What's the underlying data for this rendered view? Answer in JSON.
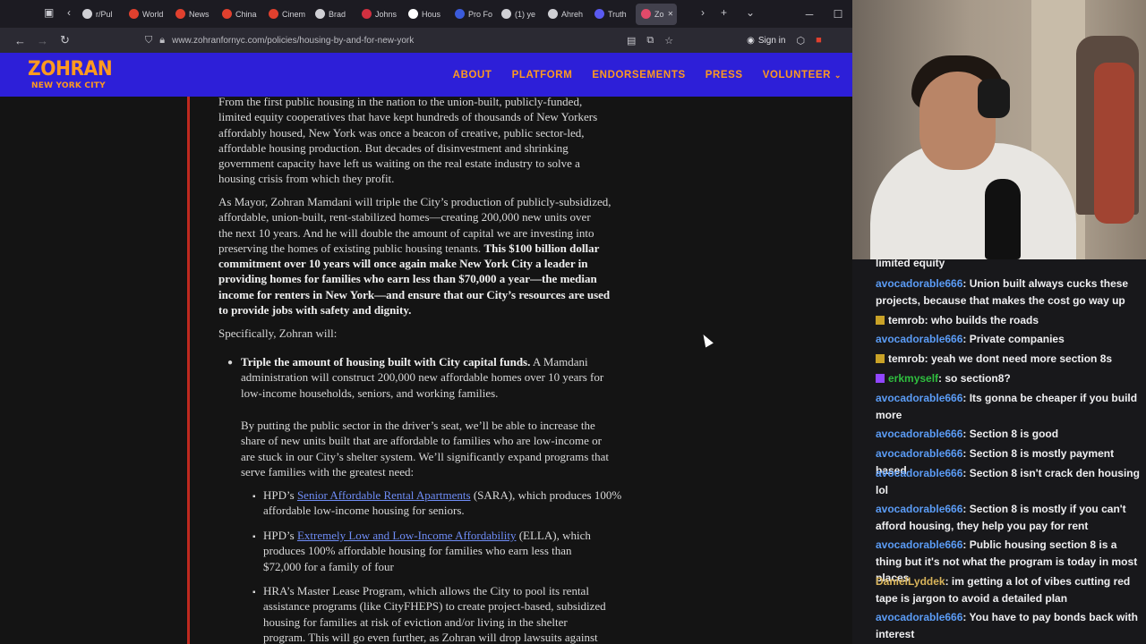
{
  "browser": {
    "tabs": [
      {
        "label": "r/Pul",
        "color": "#d0d0d5"
      },
      {
        "label": "World",
        "color": "#e0402e"
      },
      {
        "label": "News",
        "color": "#e0402e"
      },
      {
        "label": "China",
        "color": "#e0402e"
      },
      {
        "label": "Cinem",
        "color": "#e0402e"
      },
      {
        "label": "Brad",
        "color": "#d0d0d5"
      },
      {
        "label": "Johns",
        "color": "#d03040"
      },
      {
        "label": "Hous",
        "color": "#ffffff"
      },
      {
        "label": "Pro Fo",
        "color": "#3b5bdb"
      },
      {
        "label": "(1) ye",
        "color": "#d0d0d5"
      },
      {
        "label": "Ahreh",
        "color": "#d0d0d5"
      },
      {
        "label": "Truth",
        "color": "#5a5af0"
      },
      {
        "label": "Zo",
        "color": "#e04a6a",
        "active": true
      }
    ],
    "url": "www.zohranfornyc.com/policies/housing-by-and-for-new-york",
    "sign_in": "Sign in"
  },
  "site": {
    "logo": "ZOHRAN",
    "logo_sub": "NEW YORK CITY",
    "nav": [
      "ABOUT",
      "PLATFORM",
      "ENDORSEMENTS",
      "PRESS",
      "VOLUNTEER"
    ]
  },
  "article": {
    "p1": [
      "From the first public housing in the nation to the union-built, publicly-funded,",
      "limited equity cooperatives that have kept hundreds of thousands of New Yorkers",
      "affordably housed, New York was once a beacon of creative, public sector-led,",
      "affordable housing production. But decades of disinvestment and shrinking",
      "government capacity have left us waiting on the real estate industry to solve a",
      "housing crisis from which they profit."
    ],
    "p2": [
      "As Mayor, Zohran Mamdani will triple the City’s production of publicly-subsidized,",
      "affordable, union-built, rent-stabilized homes—creating 200,000 new units over",
      "the next 10 years. And he will double the amount of capital we are investing into",
      "preserving the homes of existing public housing tenants."
    ],
    "p2_bold_start": "This $100 billion dollar",
    "p2_bold": [
      "commitment over 10 years will once again make New York City a leader in",
      "providing homes for families who earn less than $70,000 a year—the median",
      "income for renters in New York—and ensure that our City’s resources are used",
      "to provide jobs with safety and dignity."
    ],
    "p3": "Specifically, Zohran will:",
    "bullet1_bold": "Triple the amount of housing built with City capital funds.",
    "bullet1_rest_start": "A Mamdani",
    "bullet1_rest": [
      "administration will construct 200,000 new affordable homes over 10 years for",
      "low-income households, seniors, and working families."
    ],
    "p4": [
      "By putting the public sector in the driver’s seat, we’ll be able to increase the",
      "share of new units built that are affordable to families who are low-income or",
      "are stuck in our City’s shelter system. We’ll significantly expand programs that",
      "serve families with the greatest need:"
    ],
    "sub1_pre": "HPD’s",
    "sub1_link": "Senior Affordable Rental Apartments",
    "sub1_post": "(SARA), which produces 100%",
    "sub1_line2": "affordable low-income housing for seniors.",
    "sub2_pre": "HPD’s",
    "sub2_link": "Extremely Low and Low-Income Affordability",
    "sub2_post": "(ELLA), which",
    "sub2_line2": "produces 100% affordable housing for families who earn less than",
    "sub2_line3": "$72,000 for a family of four",
    "sub3": [
      "HRA’s Master Lease Program, which allows the City to pool its rental",
      "assistance programs (like CityFHEPS) to create project-based, subsidized",
      "housing for families at risk of eviction and/or living in the shelter",
      "program. This will go even further, as Zohran will drop lawsuits against"
    ]
  },
  "chat": {
    "messages": [
      {
        "user": "",
        "text": "limited equity",
        "color": "#efeff1"
      },
      {
        "user": "avocadorable666",
        "text": ": Union built always cucks these projects, because that makes the cost go way up",
        "color": "#5b9cf6"
      },
      {
        "user": "temrob",
        "text": ": who builds the roads",
        "color": "#efeff1",
        "badge": "#c9a227"
      },
      {
        "user": "avocadorable666",
        "text": ": Private companies",
        "color": "#5b9cf6"
      },
      {
        "user": "temrob",
        "text": ": yeah we dont need more section 8s",
        "color": "#efeff1",
        "badge": "#c9a227"
      },
      {
        "user": "erkmyself",
        "text": ": so section8?",
        "color": "#2fbf3f",
        "badge": "#9146ff"
      },
      {
        "user": "avocadorable666",
        "text": ": Its gonna be cheaper if you build more",
        "color": "#5b9cf6"
      },
      {
        "user": "avocadorable666",
        "text": ": Section 8 is good",
        "color": "#5b9cf6"
      },
      {
        "user": "avocadorable666",
        "text": ": Section 8 is mostly payment based",
        "color": "#5b9cf6"
      },
      {
        "user": "avocadorable666",
        "text": ": Section 8 isn't crack den housing lol",
        "color": "#5b9cf6"
      },
      {
        "user": "avocadorable666",
        "text": ": Section 8 is mostly if you can't afford housing, they help you pay for rent",
        "color": "#5b9cf6"
      },
      {
        "user": "avocadorable666",
        "text": ": Public housing section 8 is a thing but it's not what the program is today in most places",
        "color": "#5b9cf6"
      },
      {
        "user": "DanielLyddek",
        "text": ": im getting a lot of vibes cutting red tape is jargon to avoid a detailed plan",
        "color": "#d9b45a"
      },
      {
        "user": "avocadorable666",
        "text": ": You have to pay bonds back with interest",
        "color": "#5b9cf6"
      }
    ]
  }
}
